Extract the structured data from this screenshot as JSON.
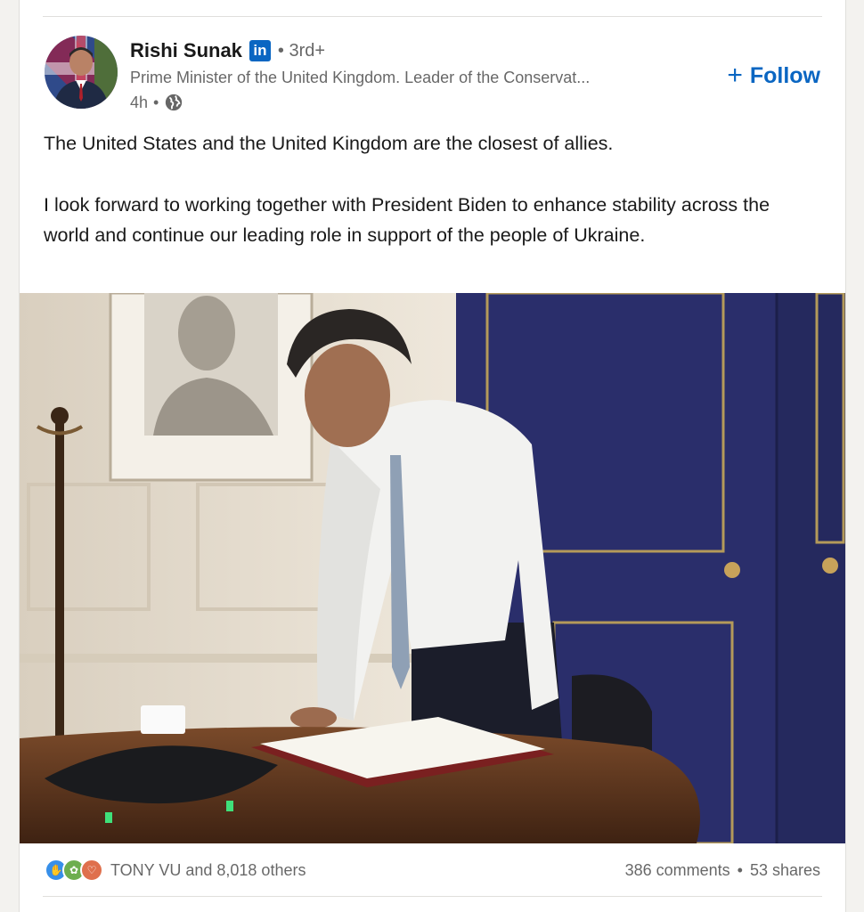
{
  "post": {
    "author": {
      "name": "Rishi Sunak",
      "badge": "in",
      "degree": "3rd+",
      "headline": "Prime Minister of the United Kingdom. Leader of the Conservat...",
      "time": "4h",
      "visibility_icon": "globe-icon"
    },
    "follow_label": "Follow",
    "text": [
      "The United States and the United Kingdom are the closest of allies.",
      "I look forward to working together with President Biden to enhance stability across the world and continue our leading role in support of the people of Ukraine."
    ],
    "image_description": "Photo of man in white shirt leaning over table",
    "reactions": {
      "icons": [
        "like-icon",
        "support-icon",
        "love-icon"
      ],
      "summary": "TONY VU and 8,018 others"
    },
    "comments": "386 comments",
    "shares": "53 shares"
  },
  "colors": {
    "accent": "#0a66c2",
    "wall_navy": "#2b2f6b",
    "wall_cream": "#e8e0d3"
  }
}
